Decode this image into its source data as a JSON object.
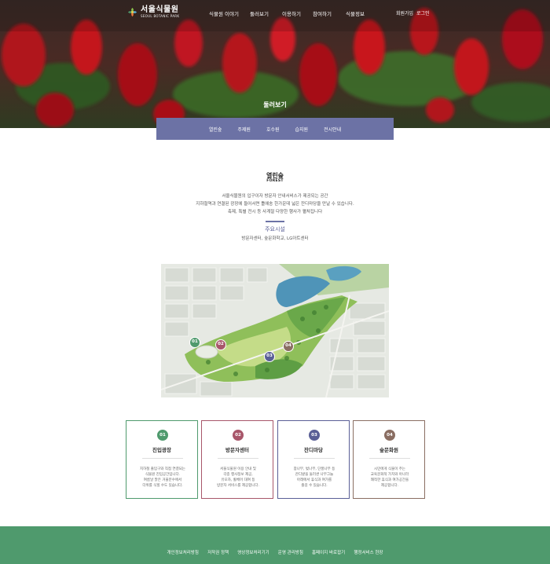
{
  "header": {
    "logo_kr": "서울식물원",
    "logo_en": "SEOUL BOTANIC PARK",
    "nav": [
      "식물원 이야기",
      "둘러보기",
      "이용하기",
      "참여하기",
      "식물정보"
    ],
    "util": [
      "회원가입",
      "로그인"
    ]
  },
  "hero": {
    "title": "둘러보기"
  },
  "subnav": [
    "열린숲",
    "주제원",
    "호수원",
    "습지원",
    "전시안내"
  ],
  "intro": {
    "title": "열린숲",
    "subtitle": "FOREST",
    "lines": [
      "서울식물원의 입구이자 방문자 안내서비스가 제공되는 공간",
      "지하철역과 연결된 광장에 들어서면 틀에송 한가운데 넓은 잔디마당을 만날 수 있습니다.",
      "축제, 특별 전시 등 사계절 다양한 행사가 펼쳐집니다"
    ],
    "facility_label": "주요시설",
    "facilities": "방문자센터, 숲문화학교, LG아트센터"
  },
  "map": {
    "markers": [
      {
        "num": "01",
        "color": "#4f9a6d"
      },
      {
        "num": "02",
        "color": "#a8566a"
      },
      {
        "num": "03",
        "color": "#5a5f96"
      },
      {
        "num": "04",
        "color": "#8a6e62"
      }
    ]
  },
  "cards": [
    {
      "num": "01",
      "title": "진입광장",
      "color": "#4f9a6d",
      "body": [
        "지하철 출입구와 직접 연결되는",
        "식물원 진입공간입니다.",
        "여름날 맑은 거울분수에서",
        "더위를 식힐 수도 있습니다."
      ]
    },
    {
      "num": "02",
      "title": "방문자센터",
      "color": "#a8566a",
      "body": [
        "서울식물원 이용 안내 및",
        "각종 행사정보 제공,",
        "유모차, 휠체어 대여 등",
        "방문자 서비스를 제공합니다."
      ]
    },
    {
      "num": "03",
      "title": "잔디마당",
      "color": "#5a5f96",
      "body": [
        "참나무, 벚나무, 단풍나무 등",
        "잔디밭을 둘러싼 나무그늘",
        "아래에서 휴식과 여가를",
        "즐길 수 있습니다."
      ]
    },
    {
      "num": "04",
      "title": "숲문화원",
      "color": "#8a6e62",
      "body": [
        "시민에게 식물이 주는",
        "교육문화적 가치와 아나라",
        "쾌적한 휴식과 여가공간을",
        "제공합니다."
      ]
    }
  ],
  "footer": {
    "links": [
      "개인정보처리방침",
      "저작권 정책",
      "영상정보처리기기",
      "운영 관리방침",
      "홈페이지 바로잡기",
      "행정서비스 헌장"
    ]
  }
}
